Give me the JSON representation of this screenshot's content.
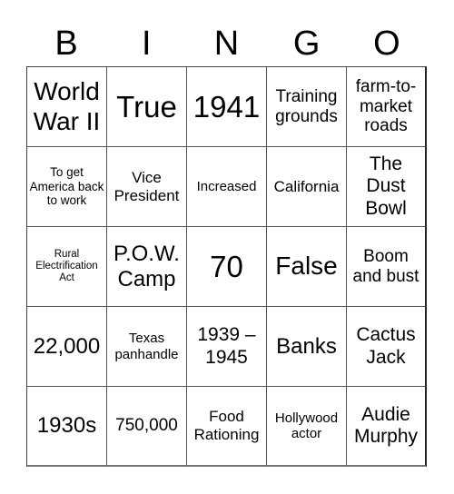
{
  "header": {
    "letters": [
      "B",
      "I",
      "N",
      "G",
      "O"
    ]
  },
  "board": {
    "rows": [
      [
        "World War II",
        "True",
        "1941",
        "Training grounds",
        "farm-to-market roads"
      ],
      [
        "To get America back to work",
        "Vice President",
        "Increased",
        "California",
        "The Dust Bowl"
      ],
      [
        "Rural Electrification Act",
        "P.O.W. Camp",
        "70",
        "False",
        "Boom and bust"
      ],
      [
        "22,000",
        "Texas panhandle",
        "1939 – 1945",
        "Banks",
        "Cactus Jack"
      ],
      [
        "1930s",
        "750,000",
        "Food Rationing",
        "Hollywood actor",
        "Audie Murphy"
      ]
    ]
  }
}
